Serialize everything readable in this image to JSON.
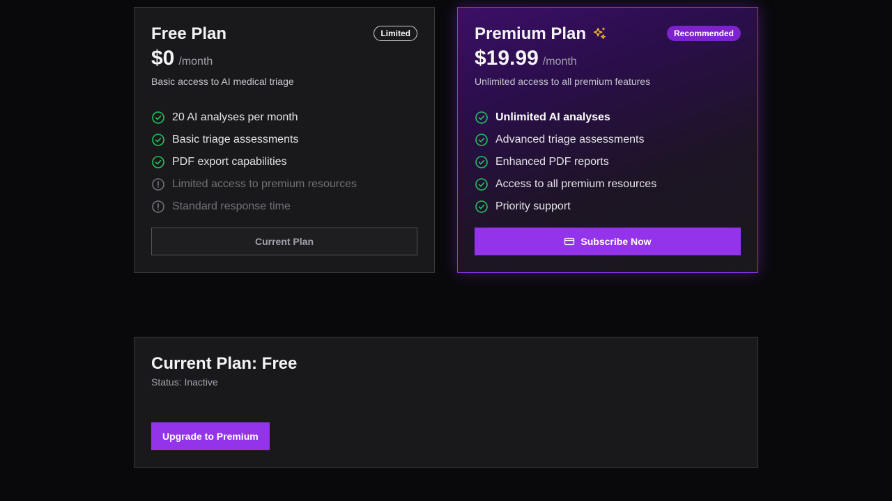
{
  "free_plan": {
    "title": "Free Plan",
    "badge": "Limited",
    "price": "$0",
    "period": "/month",
    "description": "Basic access to AI medical triage",
    "features": [
      {
        "label": "20 AI analyses per month",
        "icon": "check-circle-icon"
      },
      {
        "label": "Basic triage assessments",
        "icon": "check-circle-icon"
      },
      {
        "label": "PDF export capabilities",
        "icon": "check-circle-icon"
      },
      {
        "label": "Limited access to premium resources",
        "icon": "alert-circle-icon"
      },
      {
        "label": "Standard response time",
        "icon": "alert-circle-icon"
      }
    ],
    "button_label": "Current Plan"
  },
  "premium_plan": {
    "title": "Premium Plan",
    "title_icon": "sparkles-icon",
    "badge": "Recommended",
    "price": "$19.99",
    "period": "/month",
    "description": "Unlimited access to all premium features",
    "features": [
      {
        "label": "Unlimited AI analyses",
        "icon": "check-circle-icon"
      },
      {
        "label": "Advanced triage assessments",
        "icon": "check-circle-icon"
      },
      {
        "label": "Enhanced PDF reports",
        "icon": "check-circle-icon"
      },
      {
        "label": "Access to all premium resources",
        "icon": "check-circle-icon"
      },
      {
        "label": "Priority support",
        "icon": "check-circle-icon"
      }
    ],
    "button_label": "Subscribe Now",
    "button_icon": "credit-card-icon"
  },
  "subscription_status": {
    "title": "Current Plan: Free",
    "status": "Status: Inactive",
    "button_label": "Upgrade to Premium"
  },
  "colors": {
    "background": "#09090b",
    "card": "#19191c",
    "accent": "#9333ea",
    "check": "#22c55e",
    "sparkle": "#fbbf24",
    "muted": "#71717a"
  }
}
